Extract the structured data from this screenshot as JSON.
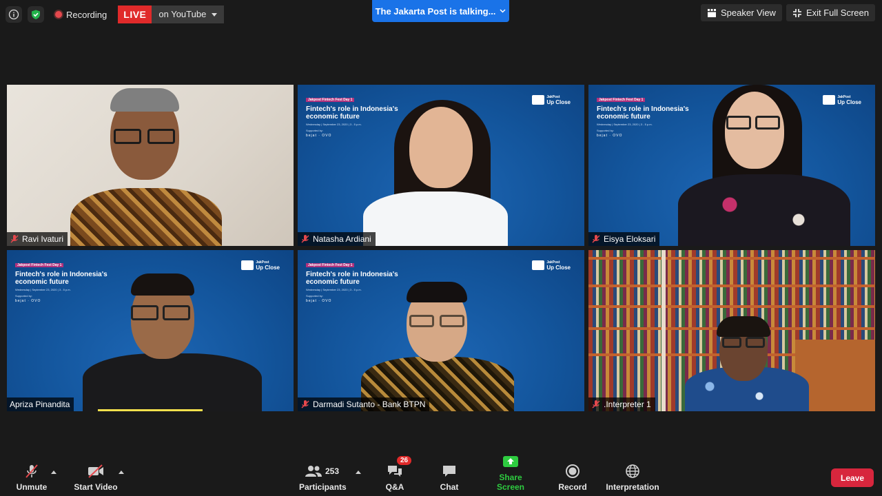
{
  "top_left": {
    "recording_label": "Recording",
    "live_label": "LIVE",
    "live_destination": "on YouTube"
  },
  "talking_banner": "The Jakarta Post is talking...",
  "top_right": {
    "speaker_view_label": "Speaker View",
    "exit_full_screen_label": "Exit Full Screen"
  },
  "banner": {
    "eyebrow": "Jakpost Fintech Fest Day 1",
    "title": "Fintech's role in Indonesia's economic future",
    "date": "Wednesday | September 23, 2020 | 3 - 5 p.m.",
    "supported_by": "Supported by:",
    "sponsors": "bejat  ·  OVO",
    "brand": "JakPost",
    "brand_sub": "Up Close"
  },
  "participants": [
    {
      "name": "Ravi Ivaturi",
      "muted": true
    },
    {
      "name": "Natasha Ardiani",
      "muted": true
    },
    {
      "name": "Eisya Eloksari",
      "muted": true
    },
    {
      "name": "Apriza Pinandita",
      "muted": false,
      "speaking": true
    },
    {
      "name": "Darmadi Sutanto - Bank BTPN",
      "muted": true
    },
    {
      "name": ".Interpreter 1",
      "muted": true
    }
  ],
  "toolbar": {
    "unmute_label": "Unmute",
    "start_video_label": "Start Video",
    "participants_label": "Participants",
    "participants_count": "253",
    "qa_label": "Q&A",
    "qa_badge": "26",
    "chat_label": "Chat",
    "share_screen_label": "Share Screen",
    "record_label": "Record",
    "interpretation_label": "Interpretation",
    "leave_label": "Leave"
  },
  "colors": {
    "accent_blue": "#1a73e8",
    "live_red": "#e02a2a",
    "share_green": "#2ecc40",
    "leave_red": "#d7263d",
    "speaking_yellow": "#f4e04d"
  }
}
